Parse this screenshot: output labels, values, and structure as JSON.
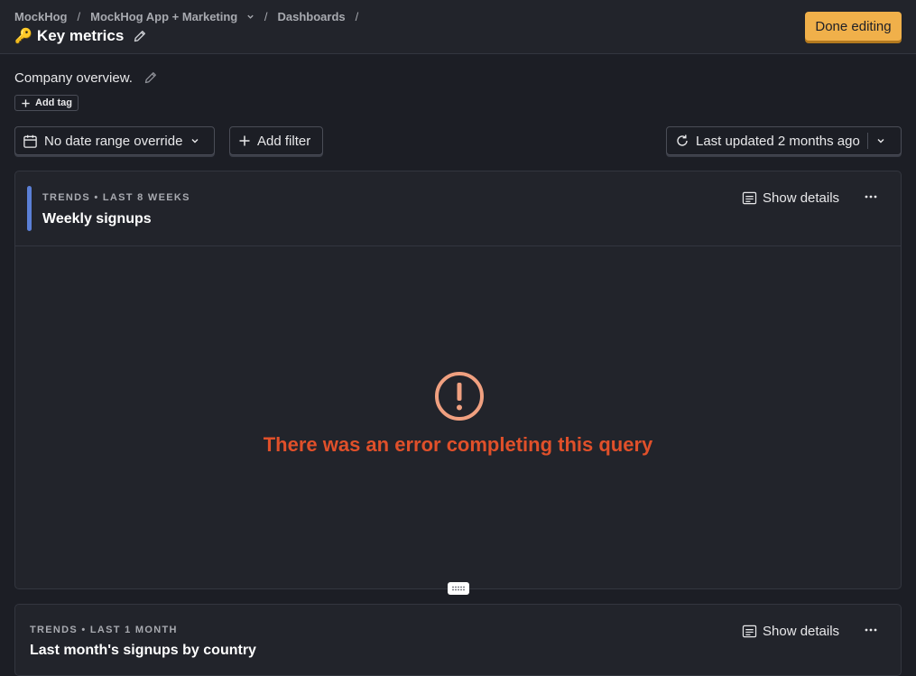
{
  "breadcrumbs": {
    "org": "MockHog",
    "project": "MockHog App + Marketing",
    "section": "Dashboards",
    "separator": "/"
  },
  "dashboard": {
    "emoji": "🔑",
    "title": "Key metrics",
    "description": "Company overview.",
    "add_tag_label": "Add tag"
  },
  "toolbar": {
    "done_label": "Done editing",
    "date_override_label": "No date range override",
    "add_filter_label": "Add filter",
    "last_updated_label": "Last updated 2 months ago"
  },
  "cards": [
    {
      "subtitle": "TRENDS • LAST 8 WEEKS",
      "title": "Weekly signups",
      "show_details_label": "Show details",
      "error_message": "There was an error completing this query"
    },
    {
      "subtitle": "TRENDS • LAST 1 MONTH",
      "title": "Last month's signups by country",
      "show_details_label": "Show details"
    }
  ],
  "colors": {
    "background": "#1c1e25",
    "card": "#22242b",
    "accent": "#f0b04a",
    "series": "#5b7fd6",
    "error": "#e0502a"
  },
  "icons": [
    "chevron-down-icon",
    "pencil-icon",
    "plus-icon",
    "calendar-icon",
    "refresh-icon",
    "details-icon",
    "more-icon",
    "error-icon",
    "drag-handle-icon"
  ]
}
